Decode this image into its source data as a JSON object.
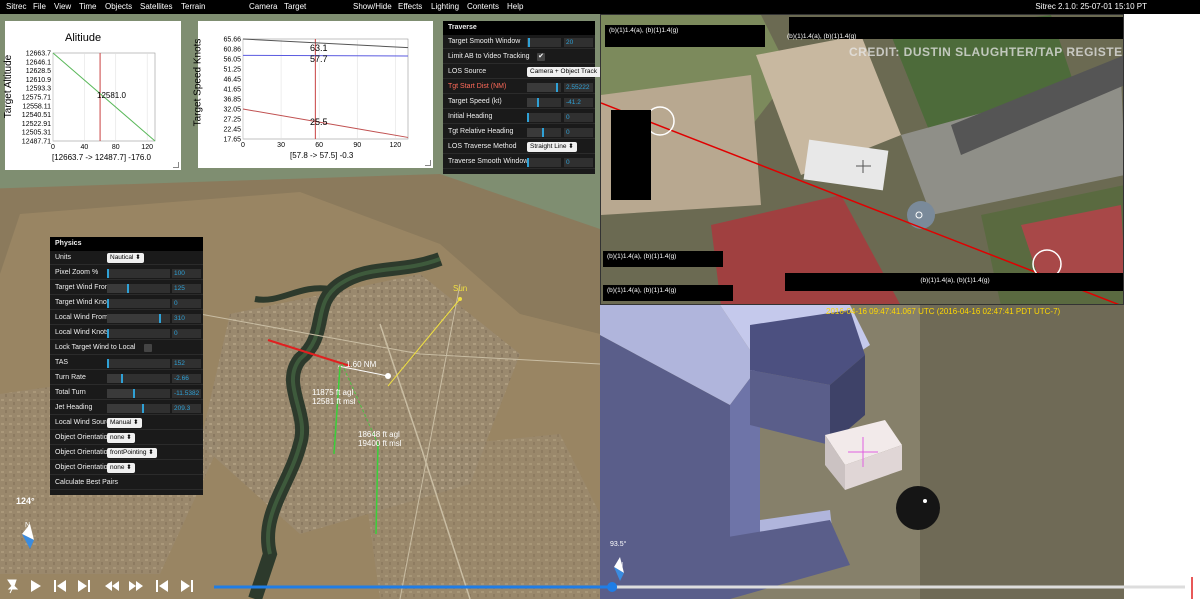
{
  "menu": {
    "items": [
      "Sitrec",
      "File",
      "View",
      "Time",
      "Objects",
      "Satellites",
      "Terrain",
      "Camera",
      "Target",
      "Show/Hide",
      "Effects",
      "Lighting",
      "Contents",
      "Help"
    ],
    "version": "Sitrec 2.1.0: 25-07-01 15:10 PT"
  },
  "altitude_chart": {
    "title": "Alitiude",
    "ylabel": "Target Altitude",
    "summary": "[12663.7 -> 12487.7] -176.0",
    "cursor_value": "12581.0",
    "chart_data": {
      "type": "line",
      "title": "Alitiude",
      "ylabel": "Target Altitude",
      "xlim": [
        0,
        130
      ],
      "ylim": [
        12487.7,
        12663.7
      ],
      "xticks": [
        "0",
        "40",
        "80",
        "120"
      ],
      "yticks": [
        "12663.7",
        "12646.1",
        "12628.5",
        "12610.9",
        "12593.3",
        "12575.71",
        "12558.11",
        "12540.51",
        "12522.91",
        "12505.31",
        "12487.71"
      ],
      "series": [
        {
          "x": [
            0,
            130
          ],
          "y": [
            12663.7,
            12487.7
          ],
          "color": "#5ab85a"
        }
      ],
      "cursor_x": 60
    }
  },
  "speed_chart": {
    "ylabel": "Target Speed Knots",
    "summary": "[57.8 -> 57.5] -0.3",
    "labels": [
      "63.1",
      "57.7",
      "25.5"
    ],
    "chart_data": {
      "type": "line",
      "ylabel": "Target Speed Knots",
      "xlim": [
        0,
        130
      ],
      "ylim": [
        17.65,
        65.66
      ],
      "xticks": [
        "0",
        "30",
        "60",
        "90",
        "120"
      ],
      "yticks": [
        "65.66",
        "60.86",
        "56.05",
        "51.25",
        "46.45",
        "41.65",
        "36.85",
        "32.05",
        "27.25",
        "22.45",
        "17.65"
      ],
      "series": [
        {
          "x": [
            0,
            130
          ],
          "y": [
            65.66,
            61.5
          ],
          "color": "#555555"
        },
        {
          "x": [
            0,
            130
          ],
          "y": [
            57.8,
            57.5
          ],
          "color": "#5a5ae0"
        },
        {
          "x": [
            0,
            130
          ],
          "y": [
            32.05,
            18.4
          ],
          "color": "#c05050"
        }
      ],
      "cursor_x": 57
    }
  },
  "traverse": {
    "title": "Traverse",
    "rows": [
      {
        "label": "Target Smooth Window",
        "type": "slider",
        "value": "20",
        "fraction": 0.1
      },
      {
        "label": "Limit AB to Video Tracking",
        "type": "check",
        "checked": true
      },
      {
        "label": "LOS Source",
        "type": "select",
        "value": "Camera + Object Track"
      },
      {
        "label": "Tgt Start Dist (NM)",
        "type": "slider",
        "value": "2.55222",
        "fraction": 0.92,
        "red": true
      },
      {
        "label": "Target Speed (kt)",
        "type": "slider",
        "value": "-41.2",
        "fraction": 0.35
      },
      {
        "label": "Initial Heading",
        "type": "slider",
        "value": "0",
        "fraction": 0.0
      },
      {
        "label": "Tgt Relative Heading",
        "type": "slider",
        "value": "0",
        "fraction": 0.5
      },
      {
        "label": "LOS Traverse Method",
        "type": "select",
        "value": "Straight Line"
      },
      {
        "label": "Traverse Smooth Window",
        "type": "slider",
        "value": "0",
        "fraction": 0.0
      }
    ]
  },
  "physics": {
    "title": "Physics",
    "rows": [
      {
        "label": "Units",
        "type": "select",
        "value": "Nautical"
      },
      {
        "label": "Pixel Zoom %",
        "type": "slider",
        "value": "100",
        "fraction": 0.03
      },
      {
        "label": "Target Wind From",
        "type": "slider",
        "value": "125",
        "fraction": 0.35
      },
      {
        "label": "Target Wind Knots",
        "type": "slider",
        "value": "0",
        "fraction": 0.0
      },
      {
        "label": "Local Wind From",
        "type": "slider",
        "value": "310",
        "fraction": 0.86
      },
      {
        "label": "Local Wind Knots",
        "type": "slider",
        "value": "0",
        "fraction": 0.0
      },
      {
        "label": "Lock Target Wind to Local",
        "type": "check",
        "checked": false
      },
      {
        "label": "TAS",
        "type": "slider",
        "value": "152",
        "fraction": 0.0
      },
      {
        "label": "Turn Rate",
        "type": "slider",
        "value": "-2.66",
        "fraction": 0.25
      },
      {
        "label": "Total Turn",
        "type": "slider",
        "value": "-11.5382",
        "fraction": 0.45
      },
      {
        "label": "Jet Heading",
        "type": "slider",
        "value": "209.3",
        "fraction": 0.58
      },
      {
        "label": "Local Wind Source",
        "type": "select",
        "value": "Manual"
      },
      {
        "label": "Object Orientation type",
        "type": "select",
        "value": "none"
      },
      {
        "label": "Object Orientation type",
        "type": "select",
        "value": "frontPointing"
      },
      {
        "label": "Object Orientation type",
        "type": "select",
        "value": "none"
      },
      {
        "label": "Calculate Best Pairs",
        "type": "button"
      }
    ]
  },
  "map": {
    "sun_label": "Sun",
    "distance_label": "1.60 NM",
    "jet_alt": [
      "11875 ft agl",
      "12581 ft msl"
    ],
    "target_alt": [
      "18648 ft agl",
      "19400 ft msl"
    ],
    "compass_deg": "124°",
    "compass_n": "N"
  },
  "video": {
    "credit": "CREDIT: DUSTIN SLAUGHTER/TAP REGISTER",
    "redactions": [
      "(b)(1)1.4(a), (b)(1)1.4(g)",
      "(b)(1)1.4(a), (b)(1)1.4(g)",
      "(b)(1)1.4(a), (b)(1)1.4(g)",
      "(b)(1)1.4(a), (b)(1)1.4(g)",
      "(b)(1)1.4(a), (b)(1)1.4(g)"
    ]
  },
  "look": {
    "timestamp": "2016-04-16 09:47:41.067 UTC  (2016-04-16 02:47:41 PDT UTC-7)",
    "compass_deg": "93.5°",
    "compass_n": "N"
  },
  "playback": {
    "buttons": [
      "pin-icon",
      "play-icon",
      "step-back-icon",
      "step-forward-icon",
      "rewind-icon",
      "fast-forward-icon",
      "skip-start-icon",
      "skip-end-icon"
    ],
    "progress": 0.41
  }
}
